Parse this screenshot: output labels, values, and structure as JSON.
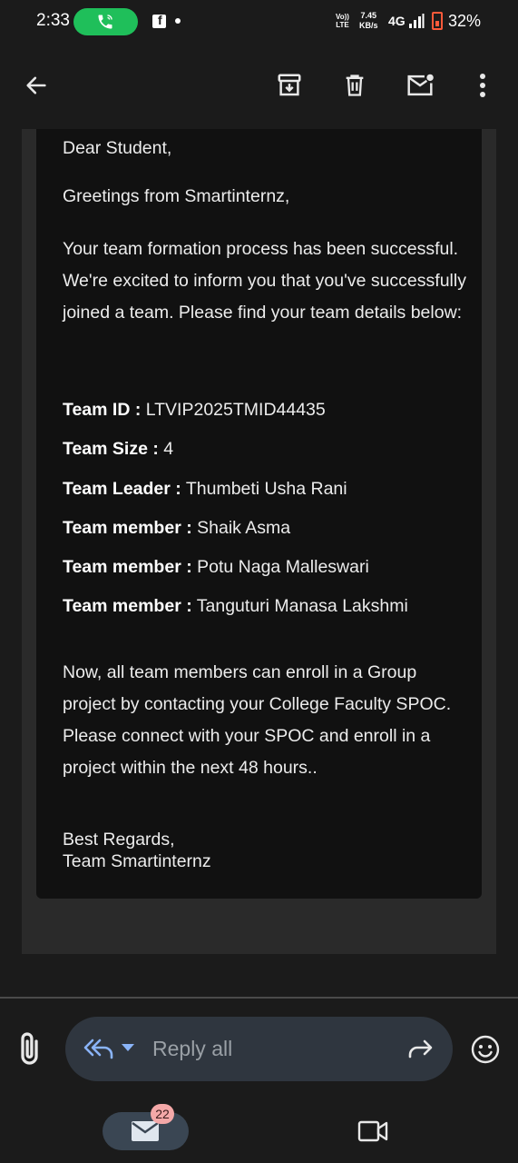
{
  "status_bar": {
    "time": "2:33",
    "volte_line1": "Vo))",
    "volte_line2": "LTE",
    "speed_value": "7.45",
    "speed_unit": "KB/s",
    "network": "4G",
    "battery": "32%",
    "icons": [
      "phone-call-icon",
      "facebook-icon",
      "signal-icon",
      "battery-icon"
    ]
  },
  "app_bar": {
    "icons": [
      "back-arrow-icon",
      "archive-icon",
      "delete-icon",
      "mark-unread-icon",
      "more-vert-icon"
    ]
  },
  "email": {
    "greeting": "Dear Student,",
    "intro": "Greetings from Smartinternz,",
    "paragraph1": "Your team formation process has been successful. We're excited to inform you that you've successfully joined a team. Please find your team details below:",
    "details": [
      {
        "label": "Team ID :",
        "value": " LTVIP2025TMID44435"
      },
      {
        "label": "Team Size :",
        "value": " 4"
      },
      {
        "label": "Team Leader :",
        "value": " Thumbeti Usha Rani"
      },
      {
        "label": "Team member :",
        "value": " Shaik Asma"
      },
      {
        "label": "Team member :",
        "value": " Potu Naga Malleswari"
      },
      {
        "label": "Team member :",
        "value": " Tanguturi Manasa Lakshmi"
      }
    ],
    "paragraph2": "Now, all team members can enroll in a Group project by contacting your College Faculty SPOC. Please connect with your SPOC and enroll in a project within the next 48 hours..",
    "sign_line1": "Best Regards,",
    "sign_line2": "Team Smartinternz"
  },
  "reply_bar": {
    "reply_label": "Reply all",
    "icons": [
      "attachment-icon",
      "reply-all-icon",
      "forward-icon",
      "emoji-icon"
    ]
  },
  "bottom_nav": {
    "mail_badge": "22",
    "icons": [
      "mail-icon",
      "video-meet-icon"
    ]
  },
  "colors": {
    "accent_blue": "#8ab4f8",
    "call_green": "#1fbf5a",
    "battery_red": "#ff5a3a"
  }
}
